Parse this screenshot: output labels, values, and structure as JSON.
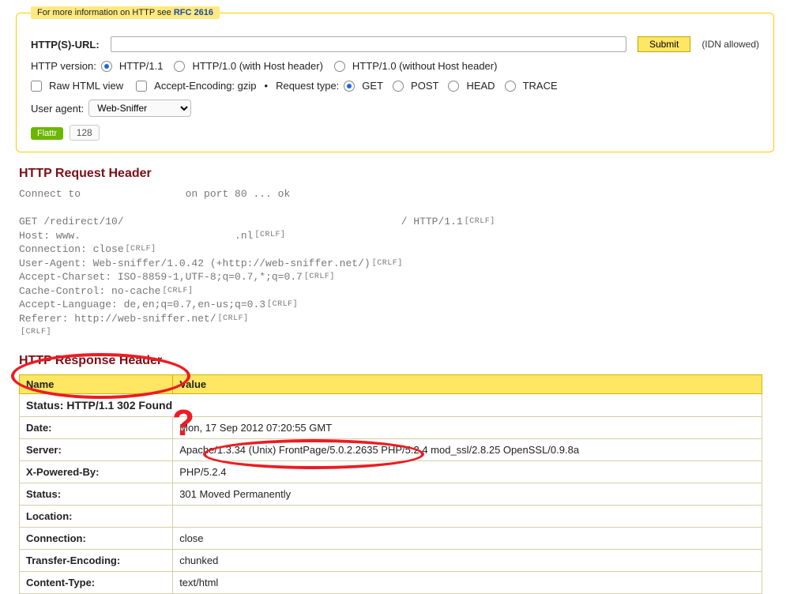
{
  "legend": {
    "pre": "For more information on HTTP see ",
    "rfc": "RFC 2616"
  },
  "form": {
    "url_label": "HTTP(S)-URL:",
    "url_value": "",
    "submit": "Submit",
    "hint": "(IDN allowed)",
    "version_label": "HTTP version:",
    "versions": [
      "HTTP/1.1",
      "HTTP/1.0 (with Host header)",
      "HTTP/1.0 (without Host header)"
    ],
    "version_selected": 0,
    "raw": "Raw HTML view",
    "gzip": "Accept-Encoding: gzip",
    "reqtype_label": "Request type:",
    "reqtypes": [
      "GET",
      "POST",
      "HEAD",
      "TRACE"
    ],
    "reqtype_selected": 0,
    "ua_label": "User agent:",
    "ua_value": "Web-Sniffer",
    "flattr_label": "Flattr",
    "flattr_count": "128"
  },
  "request": {
    "title": "HTTP Request Header",
    "connect_pre": "Connect to ",
    "connect_post": " on port 80 ... ok",
    "lines": [
      {
        "text": "GET /redirect/10/",
        "tail": "                                             / HTTP/1.1"
      },
      {
        "text": "Host: www.                         .nl"
      },
      {
        "text": "Connection: close"
      },
      {
        "text": "User-Agent: Web-sniffer/1.0.42 (+http://web-sniffer.net/)"
      },
      {
        "text": "Accept-Charset: ISO-8859-1,UTF-8;q=0.7,*;q=0.7"
      },
      {
        "text": "Cache-Control: no-cache"
      },
      {
        "text": "Accept-Language: de,en;q=0.7,en-us;q=0.3"
      },
      {
        "text": "Referer: http://web-sniffer.net/"
      }
    ],
    "crlf": "[CRLF]"
  },
  "response": {
    "title": "HTTP Response Header",
    "col_name": "Name",
    "col_value": "Value",
    "status": "Status: HTTP/1.1 302 Found",
    "rows": [
      {
        "name": "Date:",
        "value": "Mon, 17 Sep 2012 07:20:55 GMT"
      },
      {
        "name": "Server:",
        "value": "Apache/1.3.34 (Unix) FrontPage/5.0.2.2635 PHP/5.2.4 mod_ssl/2.8.25 OpenSSL/0.9.8a"
      },
      {
        "name": "X-Powered-By:",
        "value": "PHP/5.2.4"
      },
      {
        "name": "Status:",
        "value": "301 Moved Permanently"
      },
      {
        "name": "Location:",
        "value": ""
      },
      {
        "name": "Connection:",
        "value": "close"
      },
      {
        "name": "Transfer-Encoding:",
        "value": "chunked"
      },
      {
        "name": "Content-Type:",
        "value": "text/html"
      }
    ]
  },
  "annot": {
    "qmark": "?"
  }
}
